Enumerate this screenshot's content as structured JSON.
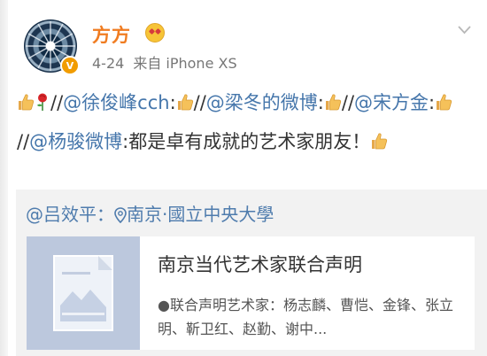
{
  "post": {
    "author": "方方",
    "verified_badge": "V",
    "date": "4-24",
    "source": "来自 iPhone XS",
    "text_segments": [
      {
        "type": "emoji",
        "icon": "thumbs-up-icon"
      },
      {
        "type": "emoji",
        "icon": "rose-icon"
      },
      {
        "type": "text",
        "text": "//"
      },
      {
        "type": "link",
        "text": "@徐俊峰cch"
      },
      {
        "type": "text",
        "text": ":"
      },
      {
        "type": "emoji",
        "icon": "thumbs-up-icon"
      },
      {
        "type": "text",
        "text": "//"
      },
      {
        "type": "link",
        "text": "@梁冬的微博"
      },
      {
        "type": "text",
        "text": ":"
      },
      {
        "type": "emoji",
        "icon": "thumbs-up-icon"
      },
      {
        "type": "text",
        "text": "//"
      },
      {
        "type": "link",
        "text": "@宋方金"
      },
      {
        "type": "text",
        "text": ":"
      },
      {
        "type": "emoji",
        "icon": "thumbs-up-icon"
      },
      {
        "type": "text",
        "text": "//"
      },
      {
        "type": "link",
        "text": "@杨骏微博"
      },
      {
        "type": "text",
        "text": ":都是卓有成就的艺术家朋友！"
      },
      {
        "type": "emoji",
        "icon": "thumbs-up-icon"
      }
    ]
  },
  "repost": {
    "author": "@吕效平",
    "separator": "：",
    "location": "南京·國立中央大學",
    "card": {
      "title": "南京当代艺术家联合声明",
      "description": "●联合声明艺术家：杨志麟、曹恺、金锋、张立明、靳卫红、赵勤、谢中..."
    }
  },
  "colors": {
    "username": "#f07c21",
    "link": "#4576ab",
    "repost_bg": "#f2f2f2",
    "meta": "#777777"
  },
  "icons": [
    "chevron-down-icon",
    "verified-v-icon",
    "vip-emoji-icon",
    "location-pin-icon",
    "article-thumbnail-icon"
  ]
}
